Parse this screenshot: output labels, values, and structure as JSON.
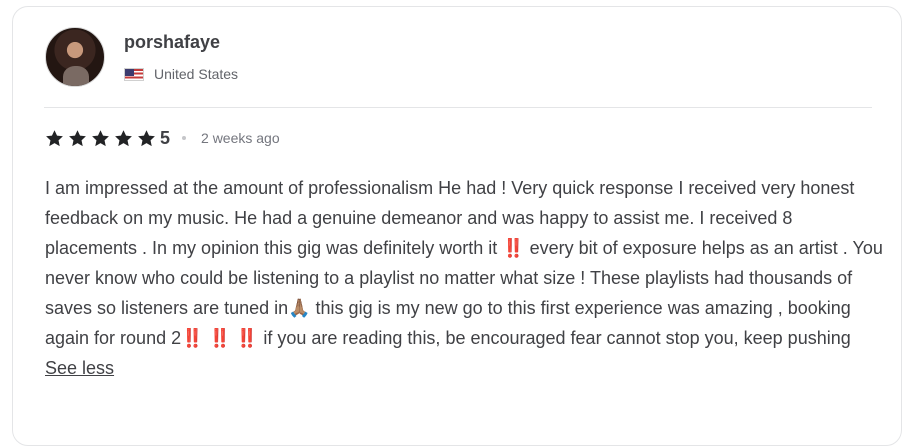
{
  "review": {
    "username": "porshafaye",
    "country": "United States",
    "rating": "5",
    "stars_filled": 5,
    "time_ago": "2 weeks ago",
    "text": "I am impressed at the amount of professionalism He had ! Very quick response I received very honest feedback on my music. He had a genuine demeanor and was happy to assist me. I received 8 placements . In my opinion this gig was definitely worth it ‼️ every bit of exposure helps as an artist . You never know who could be listening to a playlist no matter what size ! These playlists had thousands of saves so listeners are tuned in🙏🏽 this gig is my new go to this first experience was amazing , booking again for round 2‼️ ‼️ ‼️ if you are reading this, be encouraged fear cannot stop you, keep pushing",
    "see_less_label": "See less"
  },
  "icons": {
    "avatar": "user-avatar-photo",
    "flag": "us-flag-icon",
    "star": "star-icon"
  },
  "colors": {
    "text": "#404145",
    "muted": "#62646a",
    "border": "#e4e5e7",
    "star": "#222325"
  }
}
